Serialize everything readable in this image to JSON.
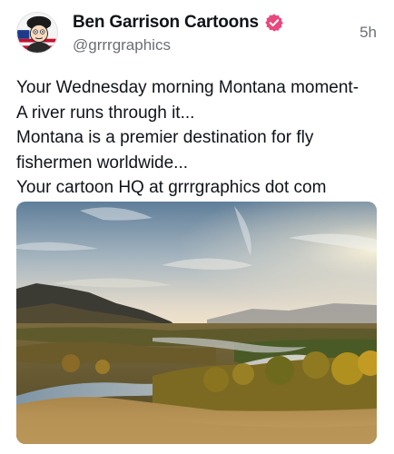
{
  "author": {
    "display_name": "Ben Garrison Cartoons",
    "handle": "@grrrgraphics",
    "avatar_icon": "cartoon-caricature-avatar",
    "verified_icon": "verified-badge-icon",
    "verified_color": "#e8497d"
  },
  "post": {
    "timestamp": "5h",
    "text_lines": [
      "Your Wednesday morning Montana moment-",
      "A river runs through it...",
      "Montana is a premier destination for fly",
      "fishermen worldwide...",
      "Your cartoon HQ at grrrgraphics dot com"
    ]
  },
  "colors": {
    "text_primary": "#0f1419",
    "text_secondary": "#6b6f74"
  }
}
